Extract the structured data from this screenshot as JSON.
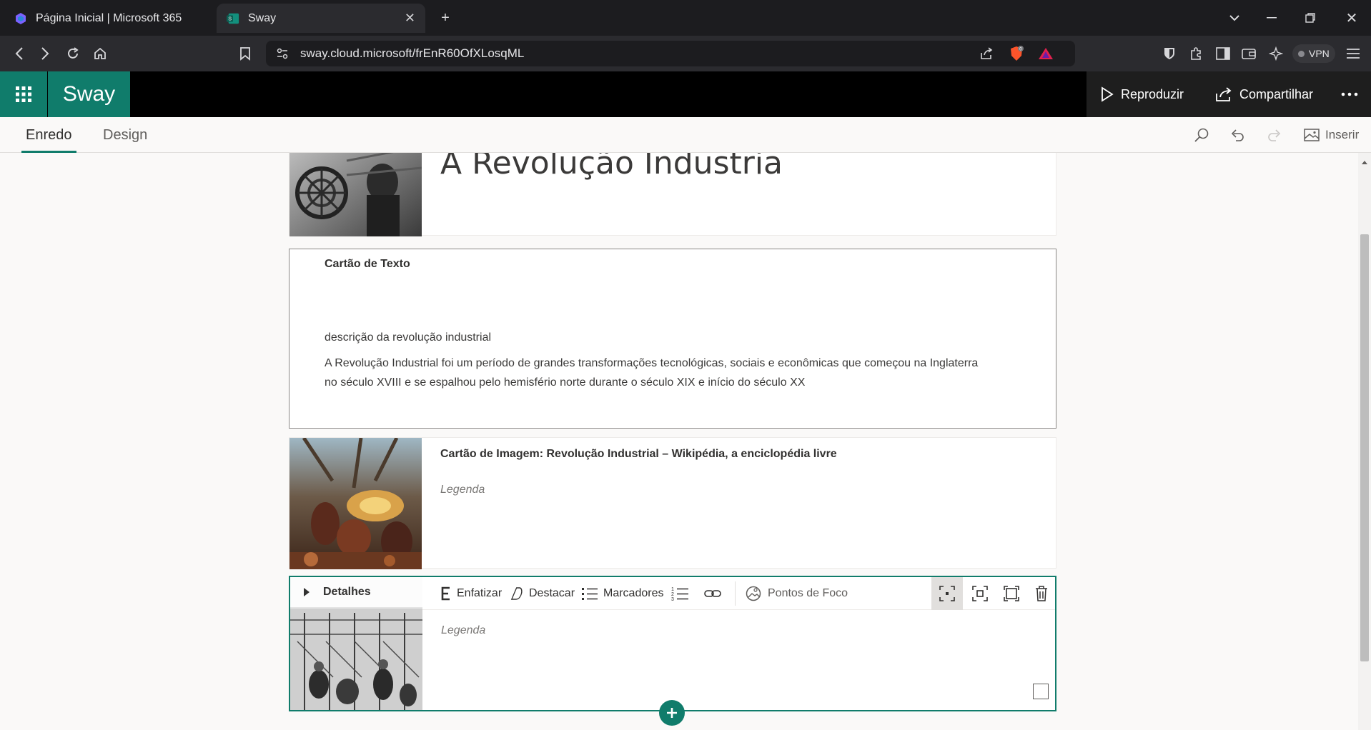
{
  "browser": {
    "tabs": [
      {
        "title": "Página Inicial | Microsoft 365",
        "icon": "microsoft365-icon"
      },
      {
        "title": "Sway",
        "icon": "sway-icon"
      }
    ],
    "url": "sway.cloud.microsoft/frEnR60OfXLosqML",
    "vpn_label": "VPN",
    "shield_count": "0"
  },
  "app": {
    "brand": "Sway",
    "accent": "#107c6b",
    "play_label": "Reproduzir",
    "share_label": "Compartilhar"
  },
  "toolbar": {
    "tabs": [
      "Enredo",
      "Design"
    ],
    "insert_label": "Inserir"
  },
  "cards": {
    "title_card": {
      "title": "A Revolução Industria"
    },
    "text_card": {
      "label": "Cartão de Texto",
      "heading": "descrição da revolução industrial",
      "paragraph_line1": "A Revolução Industrial foi um período de grandes transformações tecnológicas, sociais e econômicas que começou na Inglaterra",
      "paragraph_line2": "no século XVIII e se espalhou pelo hemisfério norte durante o século XIX e início do século XX"
    },
    "image_card": {
      "label": "Cartão de Imagem: Revolução Industrial – Wikipédia, a enciclopédia livre",
      "legend": "Legenda"
    },
    "active_card": {
      "details_label": "Detalhes",
      "legend": "Legenda",
      "format": {
        "emphasize": "Enfatizar",
        "highlight": "Destacar",
        "bullets": "Marcadores",
        "focus_points": "Pontos de Foco"
      }
    }
  }
}
